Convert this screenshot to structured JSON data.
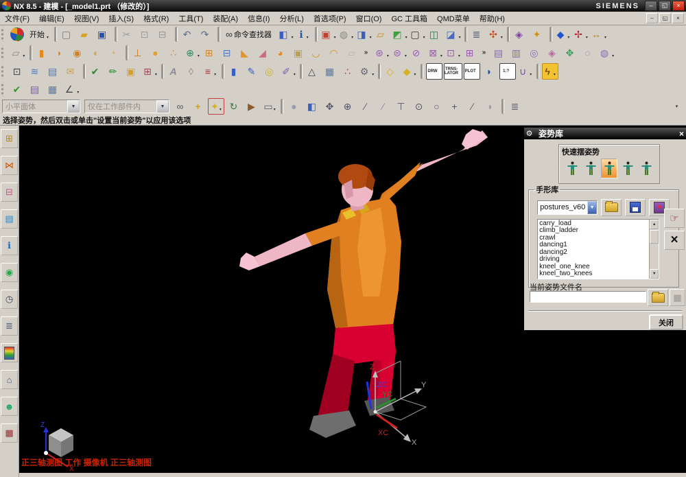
{
  "window": {
    "title": "NX 8.5 - 建模 - [_model1.prt （修改的）]",
    "brand": "SIEMENS",
    "buttons": {
      "minimize": "–",
      "restore": "◱",
      "close": "×"
    }
  },
  "menu": {
    "items": [
      "文件(F)",
      "编辑(E)",
      "视图(V)",
      "插入(S)",
      "格式(R)",
      "工具(T)",
      "装配(A)",
      "信息(I)",
      "分析(L)",
      "首选项(P)",
      "窗口(O)",
      "GC 工具箱",
      "QMD菜单",
      "帮助(H)"
    ]
  },
  "colors": {
    "chrome": "#d4d0c8",
    "viewport_bg": "#000000",
    "status_text": "#cc2200",
    "shirt": "#e08020",
    "shirt_shade": "#b86410",
    "pants": "#d80030",
    "pants_shade": "#a00020",
    "skin": "#efb6c6",
    "hair": "#b04a10",
    "shoes": "#6e6e6e",
    "selected_pose": "#f09030",
    "axis_x": "#cc2222",
    "axis_y": "#2a8f2a",
    "axis_z": "#2233dd"
  },
  "toolbars": {
    "row1": [
      {
        "n": "toolbar-grip",
        "cls": "tbico tbgrip",
        "inter": "false"
      },
      {
        "n": "nx-logo-icon",
        "cls": "tbico round",
        "st": "background:conic-gradient(#d03028 0 30%,#2a8a3a 0 55%,#2255bb 0 80%,#e8a020 0)"
      },
      {
        "n": "start-menu-button",
        "cls": "tbico tbbtn",
        "label": "开始",
        "dd": "▾"
      },
      {
        "n": "separator",
        "cls": "tbico tbsep",
        "inter": "false"
      },
      {
        "n": "new-file-button",
        "g": "▢",
        "st": "color:#777;font-weight:bold"
      },
      {
        "n": "open-file-button",
        "g": "▰",
        "st": "color:#d8a325"
      },
      {
        "n": "save-button",
        "g": "▣",
        "st": "color:#2a4fae"
      },
      {
        "n": "separator",
        "cls": "tbico tbsep",
        "inter": "false"
      },
      {
        "n": "cut-button",
        "g": "✂",
        "st": "color:#9a9a9a"
      },
      {
        "n": "copy-button",
        "g": "⊡",
        "st": "color:#9a9a9a"
      },
      {
        "n": "paste-button",
        "g": "⊟",
        "st": "color:#9a9a9a"
      },
      {
        "n": "separator",
        "cls": "tbico tbsep",
        "inter": "false"
      },
      {
        "n": "undo-button",
        "g": "↶",
        "st": "color:#5a6a8a"
      },
      {
        "n": "redo-button",
        "g": "↷",
        "st": "color:#5a6a8a"
      },
      {
        "n": "separator",
        "cls": "tbico tbsep",
        "inter": "false"
      },
      {
        "n": "command-finder-button",
        "cls": "tbico tbbtn",
        "g": "∞",
        "st": "color:#333",
        "label": "命令查找器"
      },
      {
        "n": "view-manager-button",
        "g": "◧",
        "st": "color:#3a5fc0",
        "dd": "▾"
      },
      {
        "n": "info-window-button",
        "g": "ℹ",
        "st": "color:#2255aa",
        "dd": "▾"
      },
      {
        "n": "separator",
        "cls": "tbico tbsep",
        "inter": "false"
      },
      {
        "n": "fit-view-button",
        "g": "▣",
        "st": "color:#c04030",
        "dd": "▾"
      },
      {
        "n": "display-mode-button",
        "g": "◍",
        "st": "color:#8a8a7a",
        "dd": "▾"
      },
      {
        "n": "orient-view-button",
        "g": "◨",
        "st": "color:#3a5fc0",
        "dd": "▾"
      },
      {
        "n": "view-marker-button",
        "g": "▱",
        "st": "color:#cc8822"
      },
      {
        "n": "section-view-button",
        "g": "◩",
        "st": "color:#3fa040",
        "dd": "▾"
      },
      {
        "n": "window-button",
        "g": "▢",
        "st": "color:#333",
        "dd": "▾"
      },
      {
        "n": "edit-section-button",
        "g": "◫",
        "st": "color:#2a7a4a"
      },
      {
        "n": "clip-section-button",
        "g": "◪",
        "st": "color:#4a6ac0",
        "dd": "▾"
      },
      {
        "n": "separator",
        "cls": "tbico tbsep",
        "inter": "false"
      },
      {
        "n": "sheet-operations-button",
        "g": "≣",
        "st": "color:#556677"
      },
      {
        "n": "csys-orientation-button",
        "g": "✣",
        "st": "color:#cc4411",
        "dd": "▾"
      },
      {
        "n": "separator",
        "cls": "tbico tbsep",
        "inter": "false"
      },
      {
        "n": "move-object-button",
        "g": "◈",
        "st": "color:#7a3fa0"
      },
      {
        "n": "key-options-button",
        "g": "✦",
        "st": "color:#d09010"
      },
      {
        "n": "separator",
        "cls": "tbico tbsep",
        "inter": "false"
      },
      {
        "n": "show-hide-button",
        "g": "◆",
        "st": "color:#2255cc",
        "dd": "▾"
      },
      {
        "n": "measure-button",
        "g": "✢",
        "st": "color:#b02030",
        "dd": "▾"
      },
      {
        "n": "ruler-button",
        "g": "↔",
        "st": "color:#c07a10",
        "dd": "▾"
      }
    ],
    "row2": [
      {
        "n": "toolbar-grip",
        "cls": "tbico tbgrip",
        "inter": "false"
      },
      {
        "n": "sketch-button",
        "g": "▱",
        "st": "color:#888",
        "dd": "▾"
      },
      {
        "n": "separator",
        "cls": "tbico tbsep",
        "inter": "false"
      },
      {
        "n": "extrude-button",
        "g": "▮",
        "st": "color:#e08a20"
      },
      {
        "n": "revolve-button",
        "g": "◗",
        "st": "color:#e08a20"
      },
      {
        "n": "hole-button",
        "g": "◉",
        "st": "color:#d08020"
      },
      {
        "n": "boss-button",
        "g": "◖",
        "st": "color:#e0a040"
      },
      {
        "n": "pocket-button",
        "g": "◔",
        "st": "color:#d8a860"
      },
      {
        "n": "separator",
        "cls": "tbico tbsep",
        "inter": "false"
      },
      {
        "n": "datum-plane-button",
        "g": "⊥",
        "st": "color:#cc7a22"
      },
      {
        "n": "sphere-button",
        "g": "●",
        "st": "color:#e0a030"
      },
      {
        "n": "point-set-button",
        "g": "∴",
        "st": "color:#cc8a2a"
      },
      {
        "n": "boolean-button",
        "g": "⊕",
        "st": "color:#2a8a5a",
        "dd": "▾"
      },
      {
        "n": "unite-button",
        "g": "⊞",
        "st": "color:#d08a30"
      },
      {
        "n": "subtract-button",
        "g": "⊟",
        "st": "color:#4a7ac0"
      },
      {
        "n": "trim-body-button",
        "g": "◣",
        "st": "color:#e0952a"
      },
      {
        "n": "split-body-button",
        "g": "◢",
        "st": "color:#c86a80"
      },
      {
        "n": "blend-button",
        "g": "◕",
        "st": "color:#e08a20"
      },
      {
        "n": "shell-button",
        "g": "▣",
        "st": "color:#b8a050"
      },
      {
        "n": "edge-blend-button",
        "g": "◡",
        "st": "color:#d4901a"
      },
      {
        "n": "face-blend-button",
        "g": "◠",
        "st": "color:#d4901a"
      },
      {
        "n": "draft-button",
        "g": "▱",
        "st": "color:#c8b090"
      },
      {
        "n": "more-features-chevron",
        "cls": "tbico tbchev",
        "g": "»"
      },
      {
        "n": "pattern-feature-button",
        "g": "⊛",
        "st": "color:#9a5ab0",
        "dd": "▾"
      },
      {
        "n": "mirror-feature-button",
        "g": "⊜",
        "st": "color:#9a5ab0",
        "dd": "▾"
      },
      {
        "n": "suppress-feature-button",
        "g": "⊘",
        "st": "color:#9a5ab0"
      },
      {
        "n": "edit-feature-button",
        "g": "⊠",
        "st": "color:#9a5ab0",
        "dd": "▾"
      },
      {
        "n": "move-feature-button",
        "g": "⊡",
        "st": "color:#9a5ab0",
        "dd": "▾"
      },
      {
        "n": "feature-dimensions-button",
        "g": "⊞",
        "st": "color:#9a5ab0"
      },
      {
        "n": "more-surface-chevron",
        "cls": "tbico tbchev",
        "g": "»"
      },
      {
        "n": "ruled-surface-button",
        "g": "▤",
        "st": "color:#8a6ab8"
      },
      {
        "n": "through-curves-button",
        "g": "▥",
        "st": "color:#8a6ab8"
      },
      {
        "n": "curve-mesh-button",
        "g": "◎",
        "st": "color:#8a6ab8"
      },
      {
        "n": "swept-button",
        "g": "◈",
        "st": "color:#b86a9a"
      },
      {
        "n": "xform-button",
        "g": "✥",
        "st": "color:#3a9a5a"
      },
      {
        "n": "styled-surface-button",
        "g": "◌",
        "st": "color:#8a6ab8"
      },
      {
        "n": "surface-more-button",
        "g": "◍",
        "st": "color:#8a6ab8",
        "dd": "▾"
      }
    ],
    "row3": [
      {
        "n": "toolbar-grip",
        "cls": "tbico tbgrip",
        "inter": "false"
      },
      {
        "n": "zoom-region-button",
        "g": "⊡",
        "st": "color:#444"
      },
      {
        "n": "layer-settings-button",
        "g": "≋",
        "st": "color:#4a7ac0"
      },
      {
        "n": "layer-category-button",
        "g": "▤",
        "st": "color:#4a7ac0"
      },
      {
        "n": "view-tag-button",
        "g": "✉",
        "st": "color:#c8a050"
      },
      {
        "n": "separator",
        "cls": "tbico tbsep",
        "inter": "false"
      },
      {
        "n": "move-component-button",
        "g": "✔",
        "st": "color:#2a8a2a"
      },
      {
        "n": "paint-object-button",
        "g": "✏",
        "st": "color:#2a8a2a"
      },
      {
        "n": "object-display-button",
        "g": "▣",
        "st": "color:#d8a020"
      },
      {
        "n": "annotation-button",
        "g": "⊞",
        "st": "color:#aa4455",
        "dd": "▾"
      },
      {
        "n": "separator",
        "cls": "tbico tbsep",
        "inter": "false"
      },
      {
        "n": "text-style-button",
        "g": "A",
        "st": "color:#8a8a9a;font-style:italic;font-weight:bold"
      },
      {
        "n": "eraser-button",
        "g": "◊",
        "st": "color:#9a8a8a"
      },
      {
        "n": "style-list-button",
        "g": "≡",
        "st": "color:#aa3333",
        "dd": "▾"
      },
      {
        "n": "separator",
        "cls": "tbico tbsep",
        "inter": "false"
      },
      {
        "n": "examine-geometry-button",
        "g": "▮",
        "st": "color:#3a5fc0"
      },
      {
        "n": "pen-button",
        "g": "✎",
        "st": "color:#3a5fc0"
      },
      {
        "n": "torus-button",
        "g": "◎",
        "st": "color:#d8b020"
      },
      {
        "n": "lasso-button",
        "g": "✐",
        "st": "color:#7a5ab0",
        "dd": "▾"
      },
      {
        "n": "separator",
        "cls": "tbico tbsep",
        "inter": "false"
      },
      {
        "n": "draft-analysis-button",
        "g": "△",
        "st": "color:#444455"
      },
      {
        "n": "grid-analysis-button",
        "g": "▦",
        "st": "color:#4a7ac0"
      },
      {
        "n": "point-analysis-button",
        "g": "∴",
        "st": "color:#b03040"
      },
      {
        "n": "mechanism-button",
        "g": "⚙",
        "st": "color:#666677",
        "dd": "▾"
      },
      {
        "n": "separator",
        "cls": "tbico tbsep",
        "inter": "false"
      },
      {
        "n": "model-compare-button",
        "g": "◇",
        "st": "color:#d8b020"
      },
      {
        "n": "model-update-button",
        "g": "◆",
        "st": "color:#d8b020",
        "dd": "▾"
      },
      {
        "n": "separator",
        "cls": "tbico tbsep",
        "inter": "false"
      },
      {
        "n": "drawing-button",
        "cls": "tbico tbtxt",
        "g": "DRW",
        "st": "border:1px solid #444;color:#222"
      },
      {
        "n": "translator-button",
        "cls": "tbico tbtxt",
        "g": "TRNS-\nLATOR",
        "st": "border:1px solid #444;color:#222"
      },
      {
        "n": "plot-button",
        "cls": "tbico tbtxt",
        "g": "PLOT",
        "st": "border:1px solid #444;color:#222"
      },
      {
        "n": "iso-standard-button",
        "g": "◑",
        "st": "color:#2255aa"
      },
      {
        "n": "scale-button",
        "cls": "tbico tbtxt",
        "g": "1:?",
        "st": "border:1px solid #444;color:#222;font-size:9px"
      },
      {
        "n": "constraint-button",
        "g": "∪",
        "st": "color:#7a4ab0",
        "dd": "▾"
      },
      {
        "n": "separator",
        "cls": "tbico tbsep",
        "inter": "false"
      },
      {
        "n": "quick-access-button",
        "g": "ϟ",
        "st": "background:#f2c230;color:#553300;border:1px solid #b89020",
        "dd": "▾"
      }
    ],
    "row4": [
      {
        "n": "toolbar-grip",
        "cls": "tbico tbgrip",
        "inter": "false"
      },
      {
        "n": "validate-button",
        "g": "✔",
        "st": "color:#2a9a2a"
      },
      {
        "n": "requirements-button",
        "g": "▤",
        "st": "color:#7a5ab0"
      },
      {
        "n": "spreadsheet-button",
        "g": "▦",
        "st": "color:#4a7ac0"
      },
      {
        "n": "datum-csys-button",
        "g": "∠",
        "st": "color:#444455",
        "dd": "▾"
      }
    ]
  },
  "selection_bar": {
    "combo1": "小平面体",
    "combo2": "仅在工作部件内",
    "icons": [
      {
        "n": "selection-preview-button",
        "g": "∞",
        "st": "color:#555"
      },
      {
        "n": "snap-point-button",
        "g": "+",
        "st": "color:#c8a020;font-weight:bold"
      },
      {
        "n": "enable-snap-button",
        "g": "✦",
        "st": "color:#d8b020;border:1px solid #c04040",
        "dd": "▾"
      },
      {
        "n": "orient-handle-button",
        "g": "↻",
        "st": "color:#3a7a3a"
      },
      {
        "n": "pointer-button",
        "g": "▶",
        "st": "color:#8a5a2a"
      },
      {
        "n": "marquee-select-button",
        "g": "▭",
        "st": "color:#555566",
        "dd": "▾"
      },
      {
        "n": "separator",
        "cls": "tbico tbsep",
        "inter": "false"
      },
      {
        "n": "shaded-ball-button",
        "g": "●",
        "st": "color:#9a9aa8"
      },
      {
        "n": "work-cube-button",
        "g": "◧",
        "st": "color:#3a5fc0"
      },
      {
        "n": "pan-snap-button",
        "g": "✥",
        "st": "color:#555566"
      },
      {
        "n": "rotate-snap-button",
        "g": "⊕",
        "st": "color:#555566"
      },
      {
        "n": "endpoint-snap-button",
        "g": "∕",
        "st": "color:#555566"
      },
      {
        "n": "midpoint-snap-button",
        "g": "∕",
        "st": "color:#888899"
      },
      {
        "n": "intersection-snap-button",
        "g": "⊤",
        "st": "color:#555566"
      },
      {
        "n": "arc-center-snap-button",
        "g": "⊙",
        "st": "color:#555566"
      },
      {
        "n": "quadrant-snap-button",
        "g": "○",
        "st": "color:#555566"
      },
      {
        "n": "point-snap-button",
        "g": "+",
        "st": "color:#555566"
      },
      {
        "n": "tangent-snap-button",
        "g": "∕",
        "st": "color:#555566"
      },
      {
        "n": "face-snap-button",
        "g": "◗",
        "st": "color:#9999aa"
      },
      {
        "n": "separator",
        "cls": "tbico tbsep",
        "inter": "false"
      },
      {
        "n": "clipboard-list-button",
        "g": "≣",
        "st": "color:#666677"
      },
      {
        "n": "selection-bar-more-button",
        "cls": "tbico tbchev",
        "g": "▾",
        "st": "margin-left:auto;margin-right:6px;font-size:7px"
      }
    ]
  },
  "prompt": "选择姿势，然后双击或单击\"设置当前姿势\"以应用该选项",
  "sidebar": {
    "items": [
      {
        "n": "assembly-navigator-icon",
        "g": "⊞",
        "st": "color:#b8860b"
      },
      {
        "n": "constraint-navigator-icon",
        "g": "⋈",
        "st": "color:#cc5500"
      },
      {
        "n": "part-navigator-icon",
        "g": "⊟",
        "st": "color:#cc5588"
      },
      {
        "n": "reuse-library-icon",
        "g": "▤",
        "st": "color:#2288cc"
      },
      {
        "n": "web-browser-icon",
        "g": "ℹ",
        "st": "color:#1166cc;font-weight:bold"
      },
      {
        "n": "history-icon",
        "g": "◉",
        "st": "color:#22aa44"
      },
      {
        "n": "system-clock-icon",
        "g": "◷",
        "st": "color:#334455"
      },
      {
        "n": "process-studio-icon",
        "g": "≣",
        "st": "color:#556677"
      },
      {
        "n": "roles-palette-icon",
        "st": "background:linear-gradient(#e03030,#e8d030,#30a030,#3060c0);width:13px;height:17px;border:1px solid #555"
      },
      {
        "n": "system-scenes-icon",
        "g": "⌂",
        "st": "color:#445566"
      },
      {
        "n": "roles-icon",
        "g": "☻",
        "st": "color:#22aa66"
      },
      {
        "n": "touch-explorer-icon",
        "g": "▦",
        "st": "color:#883333"
      }
    ]
  },
  "viewport": {
    "status_text": "正三轴测图 工作 摄像机 正三轴测图",
    "triad": {
      "z": "Z",
      "zc": "ZC",
      "y": "Y",
      "yc": "YC",
      "x": "X",
      "xc": "XC"
    },
    "cube": {
      "z": "Z",
      "x": "X"
    }
  },
  "dialog": {
    "title": "姿势库",
    "close_icon": "×",
    "gear_icon": "⚙",
    "quick_pose_label": "快速摆姿势",
    "quick_poses": [
      {
        "n": "quick-pose-stand-button",
        "cls": "qp"
      },
      {
        "n": "quick-pose-walk-button",
        "cls": "qp"
      },
      {
        "n": "quick-pose-tpose-button",
        "cls": "qp sel"
      },
      {
        "n": "quick-pose-reach-button",
        "cls": "qp"
      },
      {
        "n": "quick-pose-point-button",
        "cls": "qp"
      }
    ],
    "hand_library_label": "手形库",
    "combo_value": "postures_v60",
    "list_items": [
      "carry_load",
      "climb_ladder",
      "crawl",
      "dancing1",
      "dancing2",
      "driving",
      "kneel_one_knee",
      "kneel_two_knees"
    ],
    "apply_posture_glyph": "☞",
    "delete_posture_glyph": "×",
    "file_label": "当前姿势文件名",
    "file_input_value": "",
    "export_glyph": "▦",
    "close_button": "关闭"
  }
}
